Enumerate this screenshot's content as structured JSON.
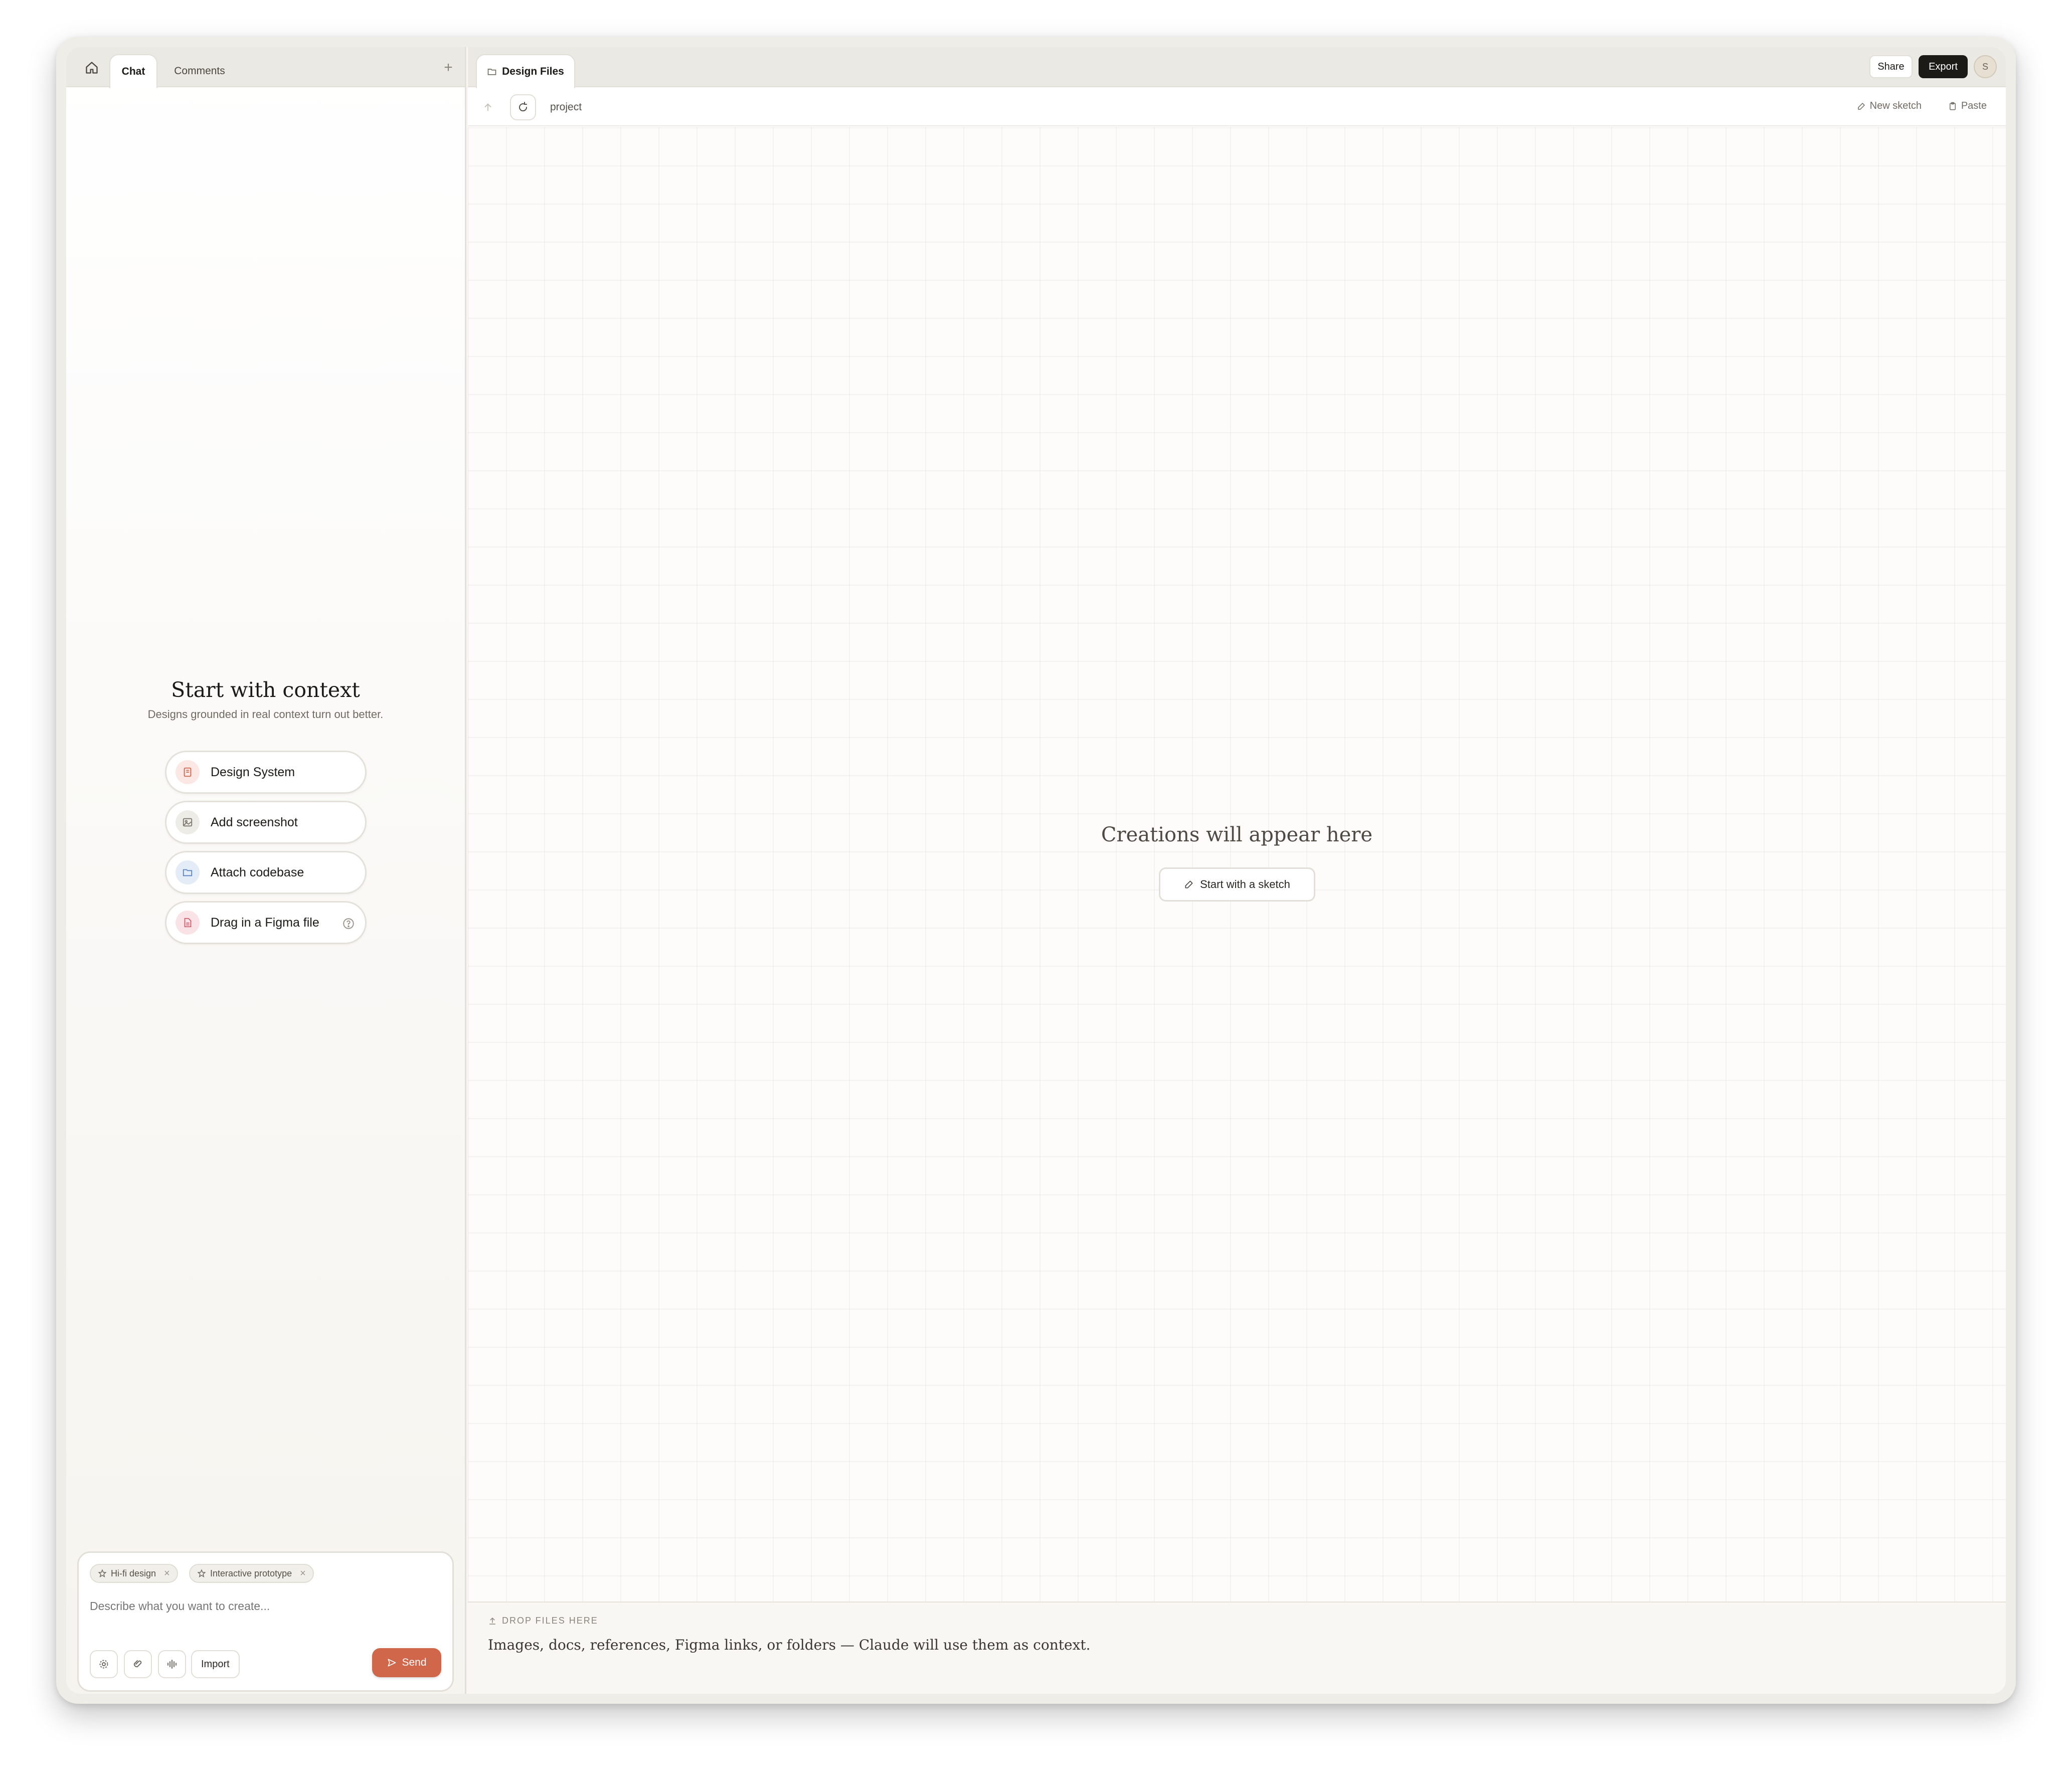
{
  "left_panel": {
    "tabs": [
      {
        "label": "Chat",
        "active": true
      },
      {
        "label": "Comments",
        "active": false
      }
    ],
    "add_tab_symbol": "+",
    "context": {
      "title": "Start with context",
      "subtitle": "Designs grounded in real context turn out better.",
      "options": [
        {
          "label": "Design System",
          "icon": "book-icon",
          "tint": "#fbe7e3",
          "color": "#d0674a"
        },
        {
          "label": "Add screenshot",
          "icon": "image-icon",
          "tint": "#eeece7",
          "color": "#7c776e"
        },
        {
          "label": "Attach codebase",
          "icon": "folder-icon",
          "tint": "#e3ecf7",
          "color": "#5b86c3"
        },
        {
          "label": "Drag in a Figma file",
          "icon": "file-icon",
          "tint": "#f9e3e6",
          "color": "#cf5f6f"
        }
      ]
    },
    "composer": {
      "chips": [
        {
          "label": "Hi-fi design"
        },
        {
          "label": "Interactive prototype"
        }
      ],
      "remove_symbol": "×",
      "placeholder": "Describe what you want to create...",
      "import_label": "Import",
      "send_label": "Send",
      "send_color": "#d0674a"
    }
  },
  "right_panel": {
    "tab_label": "Design Files",
    "share_label": "Share",
    "export_label": "Export",
    "avatar_initial": "S",
    "breadcrumb": "project",
    "new_sketch_label": "New sketch",
    "paste_label": "Paste",
    "empty_title": "Creations will appear here",
    "start_sketch_label": "Start with a sketch",
    "dropzone": {
      "heading": "DROP FILES HERE",
      "text": "Images, docs, references, Figma links, or folders — Claude will use them as context."
    }
  }
}
